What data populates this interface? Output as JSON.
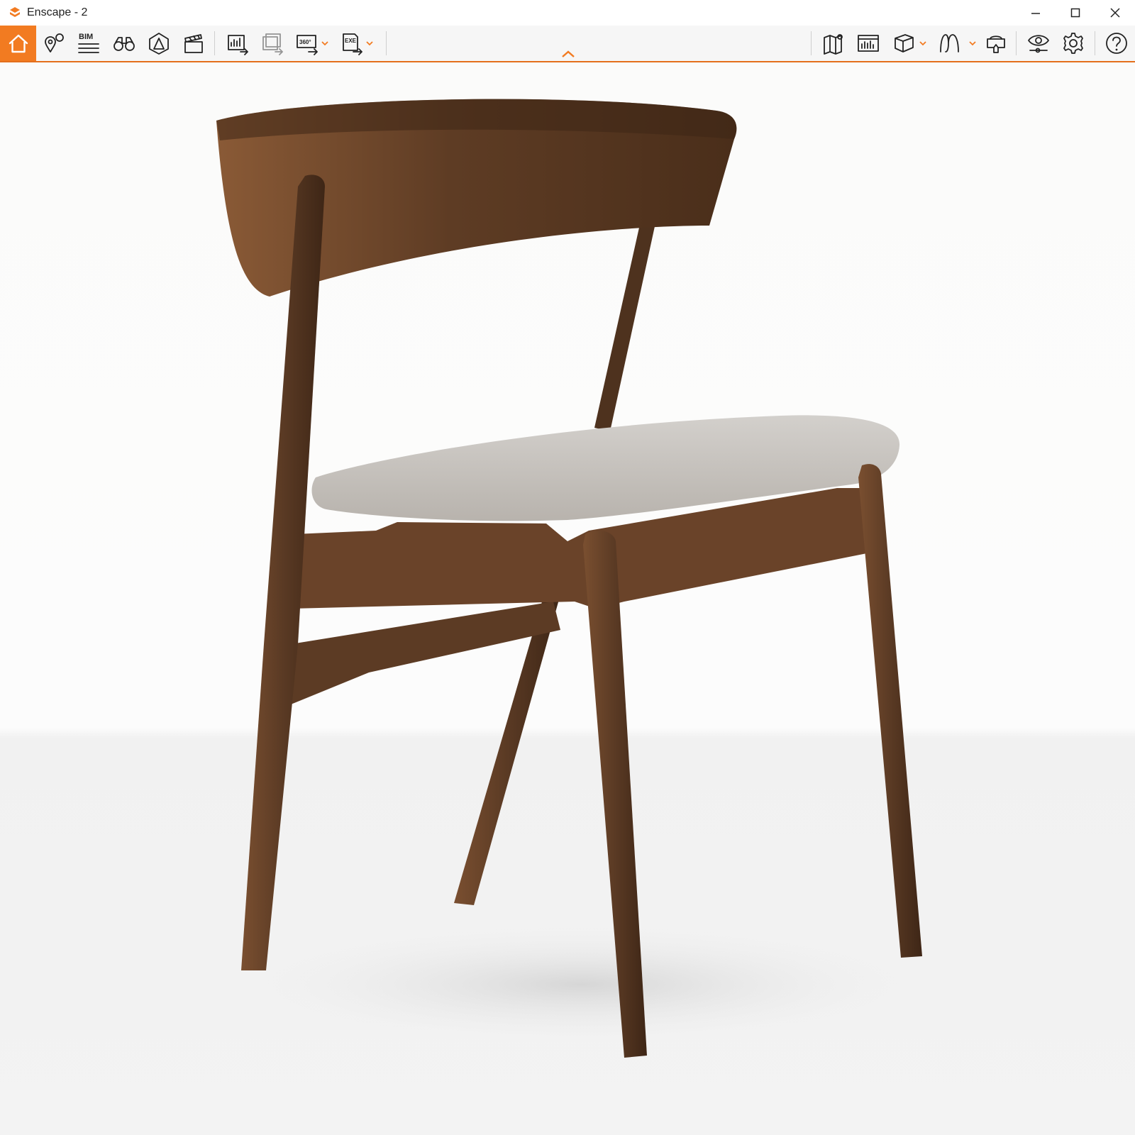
{
  "window": {
    "title": "Enscape - 2"
  },
  "toolbar": {
    "accent_color": "#f27b21",
    "left_items": [
      {
        "icon": "home-icon",
        "active": true
      },
      {
        "icon": "map-pin-icon"
      },
      {
        "icon": "bim-icon",
        "label": "BIM"
      },
      {
        "icon": "binoculars-icon"
      },
      {
        "icon": "asset-library-icon"
      },
      {
        "icon": "clapperboard-icon"
      },
      {
        "icon": "export-image-icon"
      },
      {
        "icon": "batch-export-icon"
      },
      {
        "icon": "panorama-360-icon",
        "label": "360°"
      },
      {
        "icon": "exe-export-icon",
        "label": "EXE"
      }
    ],
    "right_items": [
      {
        "icon": "map-icon"
      },
      {
        "icon": "view-management-icon"
      },
      {
        "icon": "cube-icon"
      },
      {
        "icon": "slideshow-icon"
      },
      {
        "icon": "vr-headset-icon"
      },
      {
        "icon": "visual-settings-icon"
      },
      {
        "icon": "gear-icon"
      },
      {
        "icon": "help-icon"
      }
    ]
  },
  "viewport": {
    "subject": "wooden-chair",
    "wood_color": "#5a3a24",
    "seat_color": "#c8c4bf"
  }
}
